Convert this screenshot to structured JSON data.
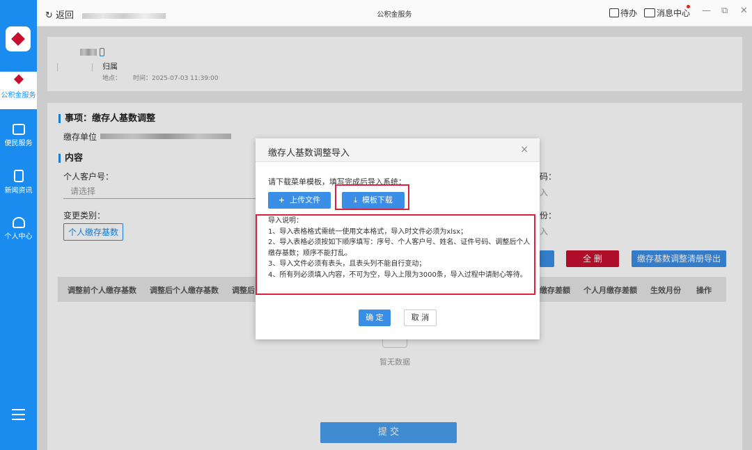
{
  "topbar": {
    "back_label": "返回",
    "window_title": "公积金服务",
    "todo_label": "待办",
    "messages_label": "消息中心",
    "minimize": "—",
    "restore": "⧉",
    "close": "✕"
  },
  "sidebar": {
    "items": [
      {
        "label": "公积金服务",
        "icon": "housing-fund-icon",
        "active": true
      },
      {
        "label": "便民服务",
        "icon": "briefcase-icon"
      },
      {
        "label": "新闻资讯",
        "icon": "news-icon"
      },
      {
        "label": "个人中心",
        "icon": "user-icon"
      }
    ],
    "menu_icon": "hamburger-menu-icon"
  },
  "header_card": {
    "name_suffix": "归属",
    "location_label": "地点：",
    "time_label": "时间：2025-07-03 11:39:00"
  },
  "matter": {
    "title": "事项：缴存人基数调整",
    "unit_label": "缴存单位"
  },
  "content_section": {
    "title": "内容",
    "customer_no_label": "个人客户号：",
    "customer_no_placeholder": "请选择",
    "change_type_label": "变更类别：",
    "change_type_value": "个人缴存基数",
    "right_label_1": "码：",
    "right_value_1": "入",
    "right_label_2": "份：",
    "right_value_2": "入"
  },
  "action_buttons": {
    "delete_all": "全 删",
    "export_list": "缴存基数调整清册导出"
  },
  "table": {
    "headers": [
      "调整前个人缴存基数",
      "调整后个人缴存基数",
      "调整后",
      "缴存差额",
      "个人月缴存差额",
      "生效月份",
      "操作"
    ],
    "empty_text": "暂无数据"
  },
  "submit_label": "提 交",
  "dialog": {
    "title": "缴存人基数调整导入",
    "close": "×",
    "tip": "请下载菜单模板，填写完成后导入系统：",
    "upload_label": "上传文件",
    "template_label": "模板下载",
    "notes": [
      "导入说明：",
      "1、导入表格格式需统一使用文本格式，导入时文件必须为xlsx；",
      "2、导入表格必须按如下顺序填写：序号、个人客户号、姓名、证件号码、调整后个人缴存基数；顺序不能打乱。",
      "3、导入文件必须有表头，且表头列不能自行变动；",
      "4、所有列必须填入内容，不可为空，导入上限为3000条，导入过程中请耐心等待。"
    ],
    "ok_label": "确 定",
    "cancel_label": "取 消"
  },
  "colors": {
    "primary": "#1a8cf0",
    "button_blue": "#3a8ee6",
    "danger": "#c8102e",
    "highlight_frame": "#e0203a"
  }
}
